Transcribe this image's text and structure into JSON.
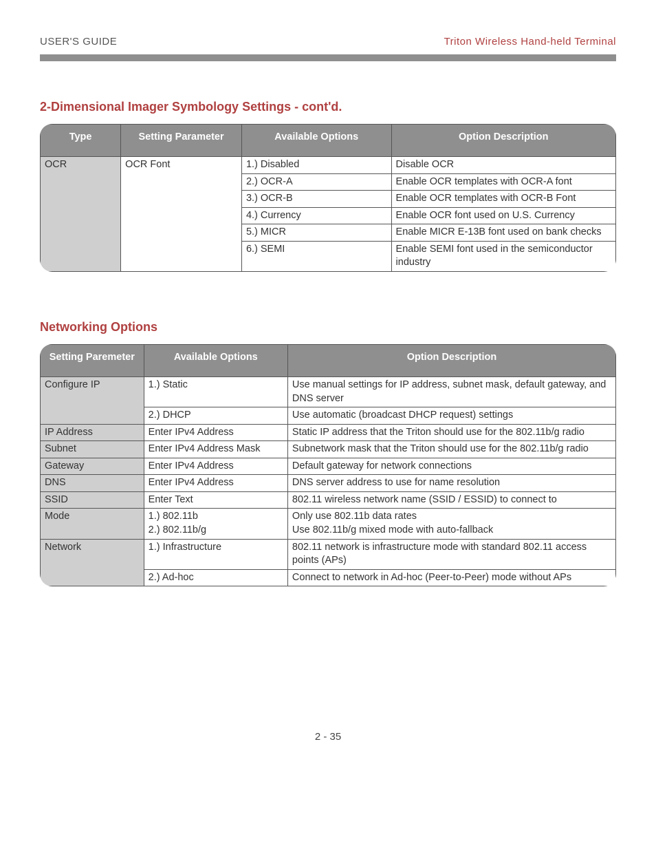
{
  "header": {
    "left": "USER'S GUIDE",
    "right": "Triton Wireless Hand-held Terminal"
  },
  "section1": {
    "title": "2-Dimensional Imager Symbology Settings - cont'd.",
    "columns": [
      "Type",
      "Setting Parameter",
      "Available Options",
      "Option Description"
    ],
    "type_label": "OCR",
    "param_label": "OCR Font",
    "rows": [
      {
        "option": "1.) Disabled",
        "desc": "Disable OCR"
      },
      {
        "option": "2.) OCR-A",
        "desc": "Enable OCR templates with OCR-A font"
      },
      {
        "option": "3.) OCR-B",
        "desc": "Enable OCR templates with OCR-B Font"
      },
      {
        "option": "4.) Currency",
        "desc": "Enable OCR font used on U.S. Currency"
      },
      {
        "option": "5.) MICR",
        "desc": "Enable MICR E-13B font used on bank checks"
      },
      {
        "option": "6.) SEMI",
        "desc": "Enable SEMI font used in the semiconductor industry"
      }
    ]
  },
  "section2": {
    "title": "Networking Options",
    "columns": [
      "Setting Paremeter",
      "Available Options",
      "Option Description"
    ],
    "rows": [
      {
        "param": "Configure IP",
        "option": "1.) Static",
        "desc": "Use manual settings for IP address, subnet mask, default gateway, and DNS server",
        "rowspan": 2
      },
      {
        "param": "",
        "option": "2.) DHCP",
        "desc": "Use automatic (broadcast DHCP request) settings"
      },
      {
        "param": "IP Address",
        "option": "Enter IPv4 Address",
        "desc": "Static IP address that the Triton should use for the 802.11b/g radio"
      },
      {
        "param": "Subnet",
        "option": "Enter IPv4 Address Mask",
        "desc": "Subnetwork mask that the Triton should use for the 802.11b/g radio"
      },
      {
        "param": "Gateway",
        "option": "Enter IPv4 Address",
        "desc": "Default gateway for network connections"
      },
      {
        "param": "DNS",
        "option": "Enter IPv4 Address",
        "desc": "DNS server address to use for name resolution"
      },
      {
        "param": "SSID",
        "option": "Enter Text",
        "desc": "802.11 wireless network name (SSID / ESSID) to connect to"
      },
      {
        "param": "Mode",
        "option": "1.) 802.11b\n2.) 802.11b/g",
        "desc": "Only use 802.11b data rates\nUse 802.11b/g mixed mode with auto-fallback"
      },
      {
        "param": "Network",
        "option": "1.) Infrastructure",
        "desc": "802.11 network is infrastructure mode with standard 802.11 access points (APs)",
        "rowspan": 2
      },
      {
        "param": "",
        "option": "2.) Ad-hoc",
        "desc": "Connect to network in Ad-hoc (Peer-to-Peer) mode without APs"
      }
    ]
  },
  "footer": {
    "page_number": "2 - 35"
  }
}
